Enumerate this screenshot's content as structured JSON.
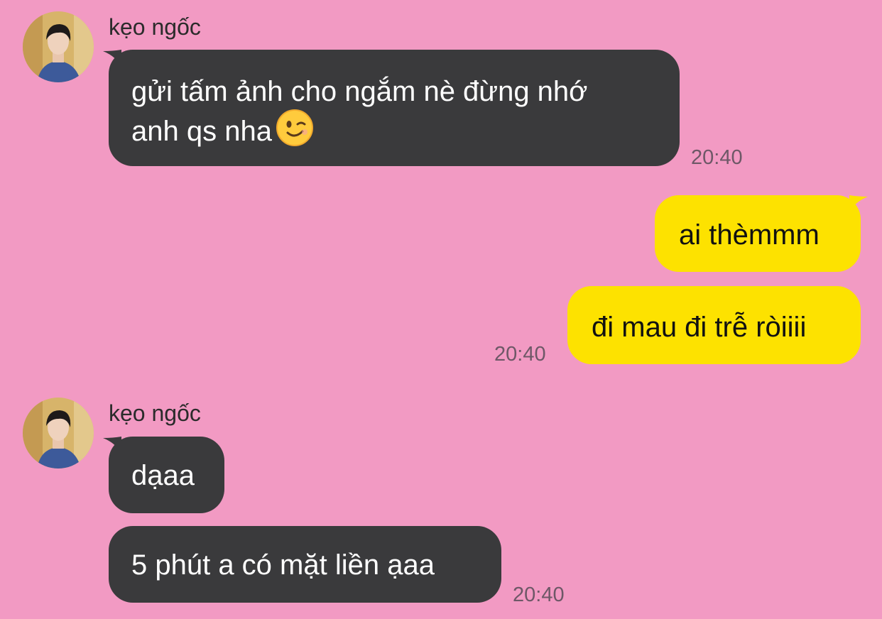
{
  "theme": {
    "background": "#f29ac3",
    "incoming_bubble": "#3a3a3c",
    "outgoing_bubble": "#fde200",
    "time_color": "#6e5867"
  },
  "messages": [
    {
      "direction": "incoming",
      "sender": "kẹo ngốc",
      "avatar_icon": "profile-photo-avatar",
      "lines": [
        "gửi tấm ảnh cho ngắm nè đừng nhớ",
        "anh qs nha"
      ],
      "emoji_icon": "winking-face-emoji",
      "time": "20:40"
    },
    {
      "direction": "outgoing",
      "text": "ai thèmmm"
    },
    {
      "direction": "outgoing",
      "text": "đi mau đi trễ ròiiii",
      "time": "20:40"
    },
    {
      "direction": "incoming",
      "sender": "kẹo ngốc",
      "avatar_icon": "profile-photo-avatar",
      "text": "dạaa"
    },
    {
      "direction": "incoming",
      "text": "5 phút a có mặt liền ạaa",
      "time": "20:40"
    }
  ]
}
